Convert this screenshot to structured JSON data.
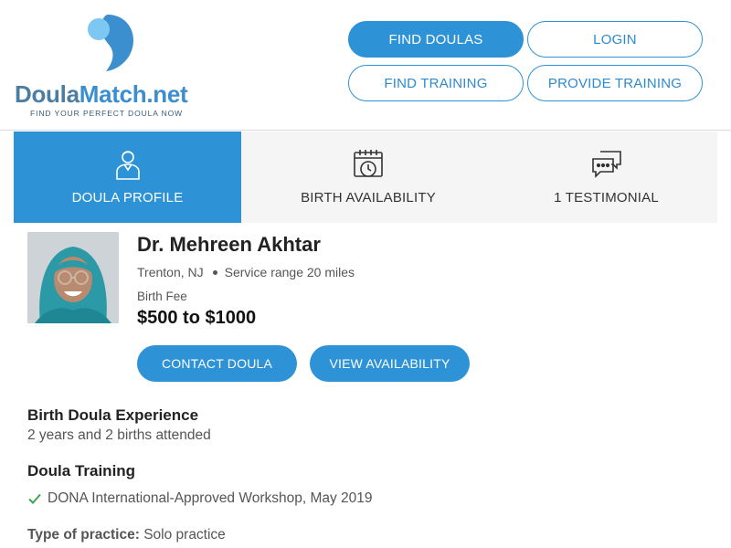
{
  "brand": {
    "name_part1": "Doula",
    "name_part2": "Match.net",
    "tagline": "FIND YOUR PERFECT DOULA NOW",
    "colors": {
      "primary": "#2d92d6",
      "logo_dark": "#4d7ea1",
      "logo_light": "#6cc0f0",
      "check": "#3aa757"
    }
  },
  "nav": {
    "find_doulas": "FIND DOULAS",
    "login": "LOGIN",
    "find_training": "FIND TRAINING",
    "provide_training": "PROVIDE TRAINING"
  },
  "tabs": [
    {
      "label": "DOULA PROFILE",
      "icon": "person-icon",
      "active": true
    },
    {
      "label": "BIRTH AVAILABILITY",
      "icon": "calendar-clock-icon",
      "active": false
    },
    {
      "label": "1 TESTIMONIAL",
      "icon": "chat-bubbles-icon",
      "active": false
    }
  ],
  "profile": {
    "name": "Dr. Mehreen Akhtar",
    "location": "Trenton, NJ",
    "service_range": "Service range 20 miles",
    "fee_label": "Birth Fee",
    "fee_value": "$500 to $1000",
    "contact_label": "CONTACT DOULA",
    "availability_label": "VIEW AVAILABILITY"
  },
  "experience": {
    "title": "Birth Doula Experience",
    "text": "2 years and 2 births attended"
  },
  "training": {
    "title": "Doula Training",
    "items": [
      "DONA International-Approved Workshop, May 2019"
    ]
  },
  "practice": {
    "label": "Type of practice:",
    "value": "Solo practice"
  }
}
